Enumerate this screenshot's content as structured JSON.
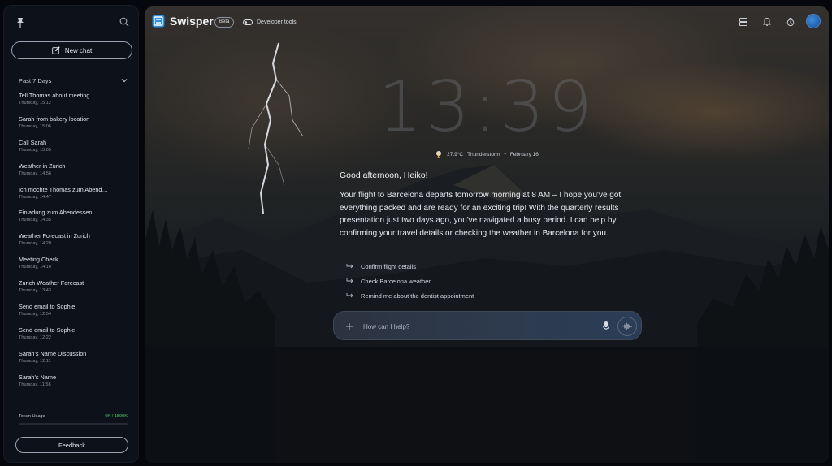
{
  "app": {
    "name": "Swisper",
    "badge": "Beta",
    "dev_tools_label": "Developer tools"
  },
  "sidebar": {
    "new_chat_label": "New chat",
    "section_label": "Past 7 Days",
    "chats": [
      {
        "title": "Tell Thomas about meeting",
        "time": "Thursday, 15:12"
      },
      {
        "title": "Sarah from bakery location",
        "time": "Thursday, 15:06"
      },
      {
        "title": "Call Sarah",
        "time": "Thursday, 15:05"
      },
      {
        "title": "Weather in Zurich",
        "time": "Thursday, 14:56"
      },
      {
        "title": "Ich möchte Thomas zum Abend…",
        "time": "Thursday, 14:47"
      },
      {
        "title": "Einladung zum Abendessen",
        "time": "Thursday, 14:35"
      },
      {
        "title": "Weather Forecast in Zurich",
        "time": "Thursday, 14:20"
      },
      {
        "title": "Meeting Check",
        "time": "Thursday, 14:10"
      },
      {
        "title": "Zurich Weather Forecast",
        "time": "Thursday, 13:43"
      },
      {
        "title": "Send email to Sophie",
        "time": "Thursday, 12:54"
      },
      {
        "title": "Send email to Sophie",
        "time": "Thursday, 12:22"
      },
      {
        "title": "Sarah's Name Discussion",
        "time": "Thursday, 12:11"
      },
      {
        "title": "Sarah's Name",
        "time": "Thursday, 11:58"
      }
    ],
    "token_usage": {
      "label": "Token Usage",
      "value": "0K / 1500K",
      "fraction": 0
    },
    "feedback_label": "Feedback"
  },
  "main": {
    "clock": "13:39",
    "weather": {
      "temp": "27.9°C",
      "condition": "Thunderstorm",
      "separator": "•",
      "date": "February 16"
    },
    "greeting": "Good afternoon, Heiko!",
    "message": "Your flight to Barcelona departs tomorrow morning at 8 AM – I hope you've got everything packed and are ready for an exciting trip! With the quarterly results presentation just two days ago, you've navigated a busy period. I can help by confirming your travel details or checking the weather in Barcelona for you.",
    "suggestions": [
      "Confirm flight details",
      "Check Barcelona weather",
      "Remind me about the dentist appointment"
    ],
    "input": {
      "placeholder": "How can I help?",
      "value": ""
    }
  },
  "colors": {
    "accent": "#3d8fe0",
    "token_green": "#4cd16b",
    "sidebar_bg": "#0d1119"
  }
}
